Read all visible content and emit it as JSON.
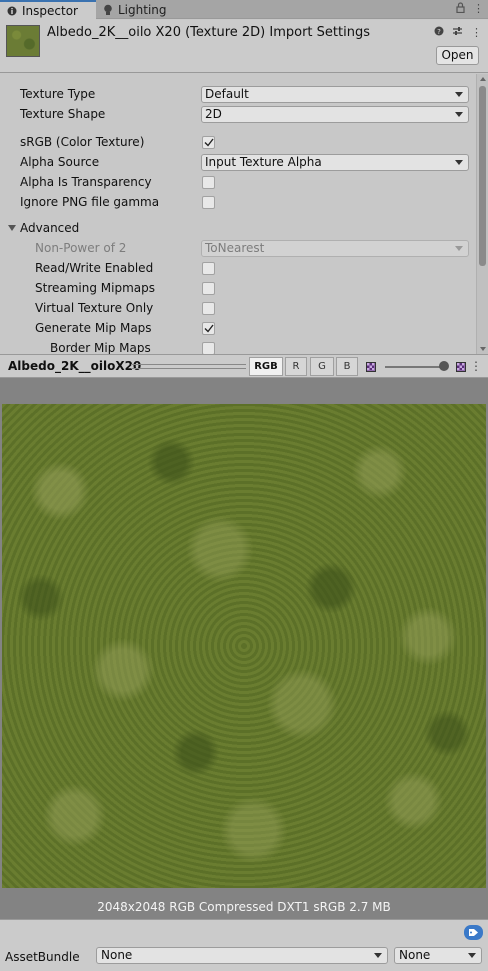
{
  "tabs": [
    {
      "label": "Inspector",
      "icon": "info-icon",
      "active": true
    },
    {
      "label": "Lighting",
      "icon": "bulb-icon",
      "active": false
    }
  ],
  "header": {
    "title": "Albedo_2K__oilo X20 (Texture 2D) Import Settings",
    "open_label": "Open"
  },
  "settings": {
    "texture_type": {
      "label": "Texture Type",
      "value": "Default"
    },
    "texture_shape": {
      "label": "Texture Shape",
      "value": "2D"
    },
    "srgb": {
      "label": "sRGB (Color Texture)",
      "checked": true
    },
    "alpha_source": {
      "label": "Alpha Source",
      "value": "Input Texture Alpha"
    },
    "alpha_transparency": {
      "label": "Alpha Is Transparency",
      "checked": false
    },
    "ignore_png_gamma": {
      "label": "Ignore PNG file gamma",
      "checked": false
    },
    "advanced": {
      "label": "Advanced"
    },
    "non_power_of_2": {
      "label": "Non-Power of 2",
      "value": "ToNearest"
    },
    "read_write": {
      "label": "Read/Write Enabled",
      "checked": false
    },
    "streaming_mipmaps": {
      "label": "Streaming Mipmaps",
      "checked": false
    },
    "virtual_texture": {
      "label": "Virtual Texture Only",
      "checked": false
    },
    "generate_mipmaps": {
      "label": "Generate Mip Maps",
      "checked": true
    },
    "border_mipmaps": {
      "label": "Border Mip Maps",
      "checked": false
    }
  },
  "preview": {
    "name": "Albedo_2K__oiloX20",
    "channels": [
      "RGB",
      "R",
      "G",
      "B"
    ],
    "active_channel": "RGB",
    "info": "2048x2048  RGB Compressed DXT1 sRGB  2.7 MB"
  },
  "asset_bundle": {
    "label": "AssetBundle",
    "name_value": "None",
    "variant_value": "None"
  },
  "colors": {
    "accent": "#3a72b0",
    "panel": "#c8c8c8"
  }
}
